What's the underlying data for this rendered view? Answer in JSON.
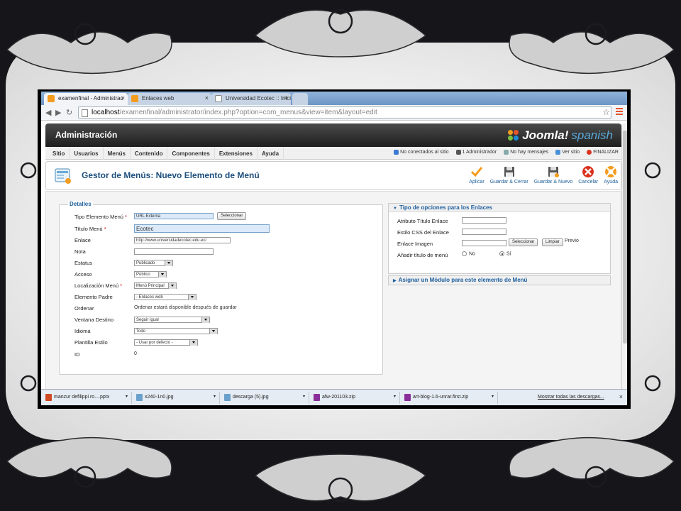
{
  "browser": {
    "tabs": [
      {
        "label": "examenfinal - Administrac",
        "active": true,
        "icon": "joomla-icon"
      },
      {
        "label": "Enlaces web",
        "active": false,
        "icon": "joomla-icon"
      },
      {
        "label": "Universidad Ecotec :: Inici",
        "active": false,
        "icon": "page-icon"
      }
    ],
    "url_host": "localhost",
    "url_path": "/examenfinal/administrator/index.php?option=com_menus&view=item&layout=edit"
  },
  "header": {
    "title": "Administración",
    "logo_main": "Joomla!",
    "logo_sub": "spanish"
  },
  "menu": {
    "items": [
      "Sitio",
      "Usuarios",
      "Menús",
      "Contenido",
      "Componentes",
      "Extensiones",
      "Ayuda"
    ],
    "status": [
      "No conectados al sitio",
      "1 Administrador",
      "No hay mensajes",
      "Ver sitio",
      "FINALIZAR"
    ]
  },
  "toolbar": {
    "page_title": "Gestor de Menús: Nuevo Elemento de Menú",
    "buttons": [
      "Aplicar",
      "Guardar & Cerrar",
      "Guardar & Nuevo",
      "Cancelar",
      "Ayuda"
    ]
  },
  "details": {
    "legend": "Detalles",
    "labels": {
      "tipo": "Tipo Elemento Menú",
      "titulo": "Título Menú",
      "enlace": "Enlace",
      "nota": "Nota",
      "estatus": "Estatus",
      "acceso": "Acceso",
      "localizacion": "Localización Menú",
      "padre": "Elemento Padre",
      "ordenar": "Ordenar",
      "ventana": "Ventana Destino",
      "idioma": "Idioma",
      "plantilla": "Plantilla Estilo",
      "id": "ID"
    },
    "values": {
      "tipo": "URL Externa",
      "tipo_btn": "Seleccionar",
      "titulo": "Ecotec",
      "enlace": "http://www.universidadecotec.edu.ec/",
      "nota": "",
      "estatus": "Publicado",
      "acceso": "Público",
      "localizacion": "Menú Principal",
      "padre": "- Enlaces web",
      "ordenar": "Ordenar estará disponible después de guardar",
      "ventana": "Seguir igual",
      "idioma": "Todo",
      "plantilla": "- Usar por defecto -",
      "id": "0"
    }
  },
  "link_options": {
    "title": "Tipo de opciones para los Enlaces",
    "labels": {
      "attr": "Atributo Título Enlace",
      "css": "Estilo CSS del Enlace",
      "img": "Enlace Imagen",
      "add": "Añadir título de menú"
    },
    "select_btn": "Seleccionar",
    "clear_btn": "Limpiar",
    "preview": "Previo",
    "radio_no": "No",
    "radio_yes": "Sí"
  },
  "module_panel": {
    "title": "Asignar un Módulo para este elemento de Menú"
  },
  "downloads": {
    "items": [
      "manzur defilippi ro....pptx",
      "x240-1n0.jpg",
      "descarga (5).jpg",
      "afw-201103.zip",
      "art-blog-1.6-unrar.first.zip"
    ],
    "show_all": "Mostrar todas las descargas..."
  },
  "colors": {
    "accent": "#1e4f7d",
    "legend_blue": "#1e5f9e",
    "joomla_orange": "#f39c1f",
    "cancel_red": "#d9321f"
  }
}
